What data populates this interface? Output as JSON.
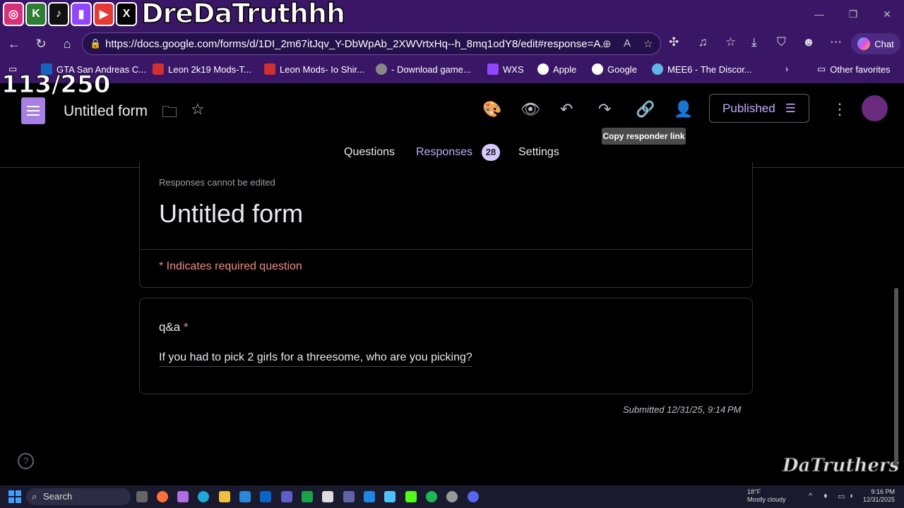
{
  "overlay": {
    "name": "DreDaTruthhh",
    "counter": "113/250",
    "watermark": "DaTruthers"
  },
  "window": {
    "minimize": "—",
    "restore": "❐",
    "close": "✕"
  },
  "browser": {
    "url": "https://docs.google.com/forms/d/1DI_2m67itJqv_Y-DbWpAb_2XWVrtxHq--h_8mq1odY8/edit#response=A...",
    "chat_label": "Chat",
    "bookmarks": [
      {
        "label": "GTA San Andreas C...",
        "color": "#1565c0"
      },
      {
        "label": "Leon 2k19 Mods-T...",
        "color": "#d32f2f"
      },
      {
        "label": "Leon Mods- Io Shir...",
        "color": "#d32f2f"
      },
      {
        "label": "- Download game...",
        "color": "#888888"
      },
      {
        "label": "WXS",
        "color": "#9146ff"
      },
      {
        "label": "Apple",
        "color": "#ffffff"
      },
      {
        "label": "Google",
        "color": "#ffffff"
      },
      {
        "label": "MEE6 - The Discor...",
        "color": "#5fb6e8"
      }
    ],
    "other_favorites": "Other favorites"
  },
  "forms": {
    "title": "Untitled form",
    "published_label": "Published",
    "tooltip": "Copy responder link",
    "tabs": [
      {
        "label": "Questions"
      },
      {
        "label": "Responses"
      },
      {
        "label": "Settings"
      }
    ],
    "response_count": "28"
  },
  "response": {
    "notice": "Responses cannot be edited",
    "form_title": "Untitled form",
    "required_note": "* Indicates required question",
    "question_label": "q&a",
    "required_star": "*",
    "answer": "If you had to pick 2 girls for a threesome, who are you picking?",
    "submitted": "Submitted 12/31/25, 9:14 PM"
  },
  "taskbar": {
    "search_label": "Search",
    "weather_temp": "18°F",
    "weather_desc": "Mostly cloudy",
    "time": "9:16 PM",
    "date": "12/31/2025"
  }
}
